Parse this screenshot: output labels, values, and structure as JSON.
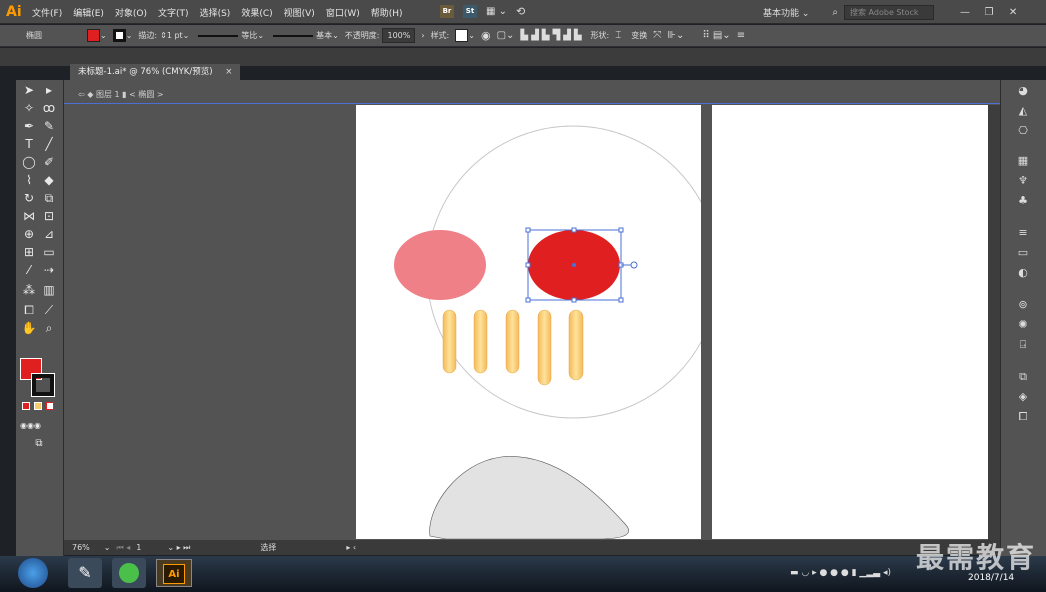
{
  "app": {
    "logo": "Ai"
  },
  "menu": [
    "文件(F)",
    "编辑(E)",
    "对象(O)",
    "文字(T)",
    "选择(S)",
    "效果(C)",
    "视图(V)",
    "窗口(W)",
    "帮助(H)"
  ],
  "menu_extras": {
    "br": "Br",
    "st": "St"
  },
  "workspace": {
    "label": "基本功能 ⌄",
    "search_placeholder": "搜索 Adobe Stock"
  },
  "control_bar": {
    "object_type": "椭圆",
    "stroke_label": "描边:",
    "stroke_value": "1 pt",
    "uniform_label": "等比",
    "basic_label": "基本",
    "opacity_label": "不透明度:",
    "opacity_value": "100%",
    "style_label": "样式:",
    "shape_label": "形状:",
    "transform_label": "变换",
    "fill_color": "#e02020"
  },
  "document_tab": {
    "title": "未标题-1.ai* @ 76% (CMYK/预览)",
    "close": "×"
  },
  "breadcrumb": {
    "layer": "图层 1",
    "object": "< 椭圆 >"
  },
  "status": {
    "zoom": "76%",
    "page": "1",
    "mode": "选择"
  },
  "taskbar": {
    "ai_label": "Ai",
    "date": "2018/7/14"
  },
  "watermark": "最需教育",
  "colors": {
    "artboard": "#ffffff",
    "fill_red": "#e02020",
    "eye_pink": "#f08088",
    "teeth": "#f7cb6e",
    "face_stroke": "#c8c8c8",
    "chin": "#e2e2e2",
    "selection": "#4a6fd6"
  }
}
